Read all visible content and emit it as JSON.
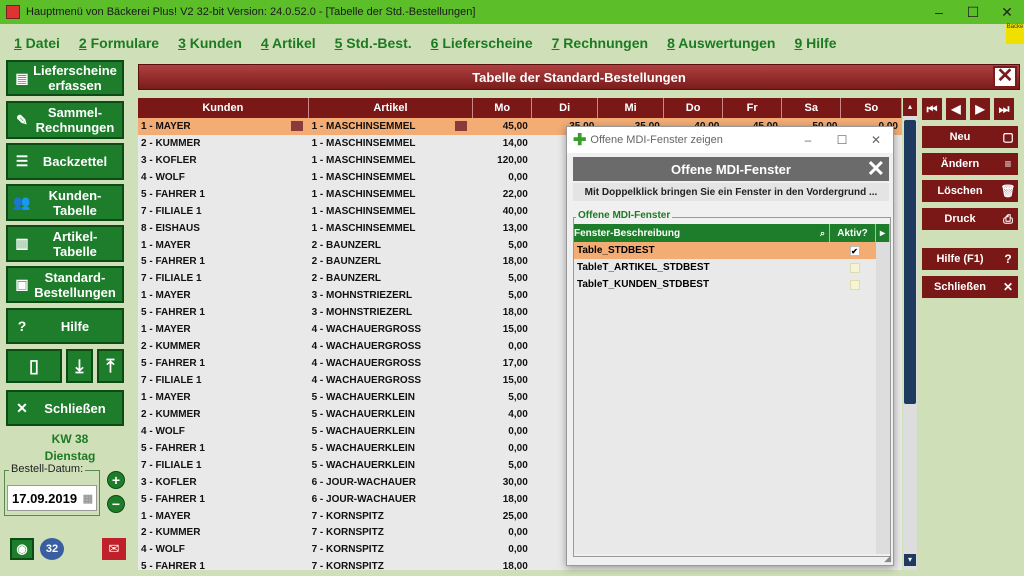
{
  "window": {
    "title": "Hauptmenü von Bäckerei Plus! V2 32-bit Version: 24.0.52.0 - [Tabelle der Std.-Bestellungen]",
    "min": "–",
    "max": "☐",
    "close": "✕",
    "badge": "Backe"
  },
  "menu": [
    {
      "key": "1",
      "label": " Datei"
    },
    {
      "key": "2",
      "label": " Formulare"
    },
    {
      "key": "3",
      "label": " Kunden"
    },
    {
      "key": "4",
      "label": " Artikel"
    },
    {
      "key": "5",
      "label": " Std.-Best."
    },
    {
      "key": "6",
      "label": " Lieferscheine"
    },
    {
      "key": "7",
      "label": " Rechnungen"
    },
    {
      "key": "8",
      "label": " Auswertungen"
    },
    {
      "key": "9",
      "label": " Hilfe"
    }
  ],
  "sidebar": {
    "lieferscheine": "Lieferscheine erfassen",
    "sammel": "Sammel-Rechnungen",
    "backzettel": "Backzettel",
    "kunden": "Kunden-Tabelle",
    "artikel": "Artikel-Tabelle",
    "standard": "Standard-Bestellungen",
    "hilfe": "Hilfe",
    "schliessen": "Schließen",
    "kw": "KW 38",
    "day": "Dienstag",
    "date_label": "Bestell-Datum:",
    "date_value": "17.09.2019"
  },
  "main": {
    "title": "Tabelle der Standard-Bestellungen",
    "columns": [
      "Kunden",
      "Artikel",
      "Mo",
      "Di",
      "Mi",
      "Do",
      "Fr",
      "Sa",
      "So"
    ],
    "rows": [
      [
        "1 - MAYER",
        "1 - MASCHINSEMMEL",
        "45,00",
        "35,00",
        "35,00",
        "40,00",
        "45,00",
        "50,00",
        "0,00"
      ],
      [
        "2 - KUMMER",
        "1 - MASCHINSEMMEL",
        "14,00",
        "",
        "",
        "",
        "",
        "",
        ""
      ],
      [
        "3 - KOFLER",
        "1 - MASCHINSEMMEL",
        "120,00",
        "",
        "",
        "",
        "",
        "",
        ""
      ],
      [
        "4 - WOLF",
        "1 - MASCHINSEMMEL",
        "0,00",
        "",
        "",
        "",
        "",
        "",
        ""
      ],
      [
        "5 - FAHRER 1",
        "1 - MASCHINSEMMEL",
        "22,00",
        "",
        "",
        "",
        "",
        "",
        ""
      ],
      [
        "7 - FILIALE 1",
        "1 - MASCHINSEMMEL",
        "40,00",
        "",
        "",
        "",
        "",
        "",
        ""
      ],
      [
        "8 - EISHAUS",
        "1 - MASCHINSEMMEL",
        "13,00",
        "",
        "",
        "",
        "",
        "",
        ""
      ],
      [
        "1 - MAYER",
        "2 - BAUNZERL",
        "5,00",
        "",
        "",
        "",
        "",
        "",
        ""
      ],
      [
        "5 - FAHRER 1",
        "2 - BAUNZERL",
        "18,00",
        "",
        "",
        "",
        "",
        "",
        ""
      ],
      [
        "7 - FILIALE 1",
        "2 - BAUNZERL",
        "5,00",
        "",
        "",
        "",
        "",
        "",
        ""
      ],
      [
        "1 - MAYER",
        "3 - MOHNSTRIEZERL",
        "5,00",
        "",
        "",
        "",
        "",
        "",
        ""
      ],
      [
        "5 - FAHRER 1",
        "3 - MOHNSTRIEZERL",
        "18,00",
        "",
        "",
        "",
        "",
        "",
        ""
      ],
      [
        "1 - MAYER",
        "4 - WACHAUERGROSS",
        "15,00",
        "",
        "",
        "",
        "",
        "",
        ""
      ],
      [
        "2 - KUMMER",
        "4 - WACHAUERGROSS",
        "0,00",
        "",
        "",
        "",
        "",
        "",
        ""
      ],
      [
        "5 - FAHRER 1",
        "4 - WACHAUERGROSS",
        "17,00",
        "",
        "",
        "",
        "",
        "",
        ""
      ],
      [
        "7 - FILIALE 1",
        "4 - WACHAUERGROSS",
        "15,00",
        "",
        "",
        "",
        "",
        "",
        ""
      ],
      [
        "1 - MAYER",
        "5 - WACHAUERKLEIN",
        "5,00",
        "",
        "",
        "",
        "",
        "",
        ""
      ],
      [
        "2 - KUMMER",
        "5 - WACHAUERKLEIN",
        "4,00",
        "",
        "",
        "",
        "",
        "",
        ""
      ],
      [
        "4 - WOLF",
        "5 - WACHAUERKLEIN",
        "0,00",
        "",
        "",
        "",
        "",
        "",
        ""
      ],
      [
        "5 - FAHRER 1",
        "5 - WACHAUERKLEIN",
        "0,00",
        "",
        "",
        "",
        "",
        "",
        ""
      ],
      [
        "7 - FILIALE 1",
        "5 - WACHAUERKLEIN",
        "5,00",
        "",
        "",
        "",
        "",
        "",
        ""
      ],
      [
        "3 - KOFLER",
        "6 - JOUR-WACHAUER",
        "30,00",
        "",
        "",
        "",
        "",
        "",
        ""
      ],
      [
        "5 - FAHRER 1",
        "6 - JOUR-WACHAUER",
        "18,00",
        "",
        "",
        "",
        "",
        "",
        ""
      ],
      [
        "1 - MAYER",
        "7 - KORNSPITZ",
        "25,00",
        "",
        "",
        "",
        "",
        "",
        ""
      ],
      [
        "2 - KUMMER",
        "7 - KORNSPITZ",
        "0,00",
        "",
        "",
        "",
        "",
        "",
        ""
      ],
      [
        "4 - WOLF",
        "7 - KORNSPITZ",
        "0,00",
        "",
        "",
        "",
        "",
        "",
        ""
      ],
      [
        "5 - FAHRER 1",
        "7 - KORNSPITZ",
        "18,00",
        "",
        "",
        "",
        "",
        "",
        ""
      ]
    ]
  },
  "right": {
    "neu": "Neu",
    "aendern": "Ändern",
    "loeschen": "Löschen",
    "druck": "Druck",
    "hilfe": "Hilfe (F1)",
    "schliessen": "Schließen"
  },
  "dialog": {
    "title": "Offene MDI-Fenster zeigen",
    "header": "Offene MDI-Fenster",
    "info": "Mit Doppelklick bringen Sie ein Fenster in den Vordergrund ...",
    "group": "Offene MDI-Fenster",
    "col_desc": "Fenster-Beschreibung",
    "col_active": "Aktiv?",
    "rows": [
      {
        "name": "Table_STDBEST",
        "active": true
      },
      {
        "name": "TableT_ARTIKEL_STDBEST",
        "active": false
      },
      {
        "name": "TableT_KUNDEN_STDBEST",
        "active": false
      }
    ]
  }
}
